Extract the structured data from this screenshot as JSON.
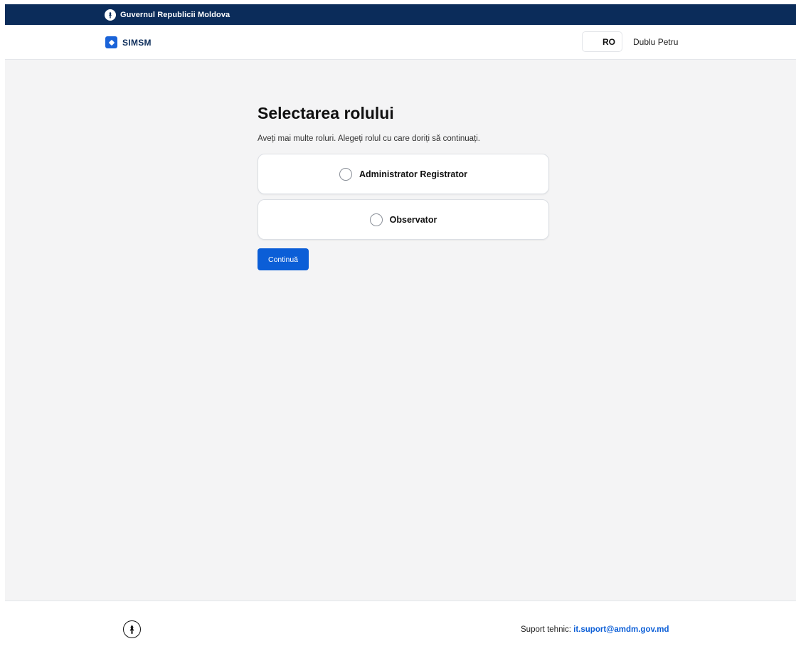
{
  "gov_bar": {
    "title": "Guvernul Republicii Moldova",
    "emblem_icon": "moldova-emblem-icon"
  },
  "header": {
    "app_name": "SIMSM",
    "logo_icon": "simsm-logo-icon",
    "language": "RO",
    "user_name": "Dublu Petru"
  },
  "main": {
    "title": "Selectarea rolului",
    "subtitle": "Aveți mai multe roluri. Alegeți rolul cu care doriți să continuați.",
    "roles": [
      {
        "label": "Administrator Registrator",
        "selected": false
      },
      {
        "label": "Observator",
        "selected": false
      }
    ],
    "continue_label": "Continuă"
  },
  "footer": {
    "support_label": "Suport tehnic: ",
    "support_email": "it.suport@amdm.gov.md",
    "emblem_icon": "moldova-emblem-icon"
  },
  "colors": {
    "gov_bar": "#0b2c5a",
    "accent": "#0b5ed7",
    "background": "#f4f4f5"
  }
}
